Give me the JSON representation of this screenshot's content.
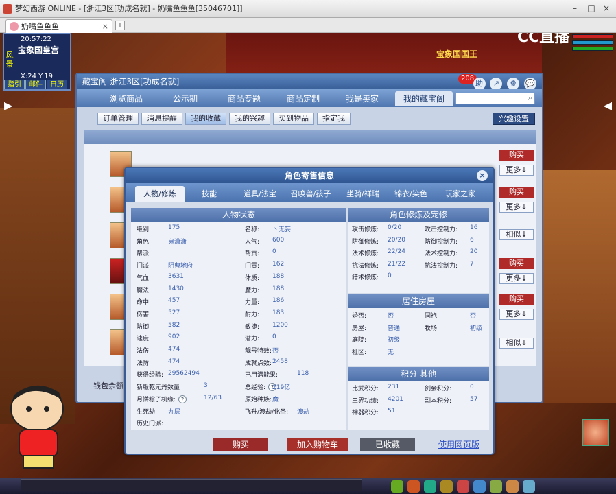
{
  "window": {
    "title": "梦幻西游 ONLINE - [浙江3区[功成名就] - 奶嘴鱼鱼鱼[35046701]]",
    "tab_label": "奶嘴鱼鱼鱼",
    "tab_close": "×",
    "tab_add": "+",
    "minimize": "–",
    "maximize": "□",
    "close": "×"
  },
  "hud": {
    "time": "20:57:22",
    "location": "宝象国皇宫",
    "side": "风景",
    "coords": "X:24  Y:19",
    "buttons": [
      "指引",
      "邮件",
      "日历"
    ],
    "cc_logo": "CC直播",
    "npc": "宝象国国王"
  },
  "panel": {
    "title": "藏宝阁-浙江3区[功成名就]",
    "badge": "208",
    "icons": [
      "助",
      "↗",
      "⚙",
      "💬"
    ],
    "nav": [
      "浏览商品",
      "公示期",
      "商品专题",
      "商品定制",
      "我是卖家",
      "我的藏宝阁"
    ],
    "sub": [
      "订单管理",
      "消息提醒",
      "我的收藏",
      "我的兴趣",
      "买到物品",
      "指定我"
    ],
    "interest": "兴趣设置",
    "buy": "购买",
    "more": "更多↓",
    "similar": "相似↓",
    "wallet": "钱包余额"
  },
  "modal": {
    "title": "角色寄售信息",
    "close": "×",
    "tabs": [
      "人物/修炼",
      "技能",
      "道具/法宝",
      "召唤兽/孩子",
      "坐骑/祥瑞",
      "锦衣/染色",
      "玩家之家"
    ],
    "left_title": "人物状态",
    "left_a": [
      {
        "k": "级别:",
        "v": "175"
      },
      {
        "k": "角色:",
        "v": "鬼潇潇"
      },
      {
        "k": "帮派:",
        "v": ""
      },
      {
        "k": "门派:",
        "v": "阴曹地府"
      },
      {
        "k": "气血:",
        "v": "3631"
      },
      {
        "k": "魔法:",
        "v": "1430"
      },
      {
        "k": "命中:",
        "v": "457"
      },
      {
        "k": "伤害:",
        "v": "527"
      },
      {
        "k": "防御:",
        "v": "582"
      },
      {
        "k": "速度:",
        "v": "902"
      },
      {
        "k": "法伤:",
        "v": "474"
      },
      {
        "k": "法防:",
        "v": "474"
      },
      {
        "k": "获得经验:",
        "v": "29562494"
      },
      {
        "k": "新版乾元丹数量",
        "v": "3"
      },
      {
        "k": "月饼粽子机缘:",
        "v": "12/63"
      },
      {
        "k": "生死劫:",
        "v": "九层"
      },
      {
        "k": "历史门派:",
        "v": ""
      }
    ],
    "left_b": [
      {
        "k": "名称:",
        "v": "丶无妄"
      },
      {
        "k": "人气:",
        "v": "600"
      },
      {
        "k": "帮贡:",
        "v": "0"
      },
      {
        "k": "门贡:",
        "v": "162"
      },
      {
        "k": "体质:",
        "v": "188"
      },
      {
        "k": "魔力:",
        "v": "188"
      },
      {
        "k": "力量:",
        "v": "186"
      },
      {
        "k": "耐力:",
        "v": "183"
      },
      {
        "k": "敏捷:",
        "v": "1200"
      },
      {
        "k": "潜力:",
        "v": "0"
      },
      {
        "k": "靓号特效:",
        "v": "否"
      },
      {
        "k": "成就点数:",
        "v": "2458"
      },
      {
        "k": "已用潜能果:",
        "v": "118"
      },
      {
        "k": "总经验:",
        "v": "219亿"
      },
      {
        "k": "原始种族:",
        "v": "魔"
      },
      {
        "k": "飞升/渡劫/化圣:",
        "v": "渡劫"
      }
    ],
    "cultivation_title": "角色修炼及宠修",
    "cultivation": [
      {
        "k": "攻击修炼:",
        "v": "0/20",
        "k2": "攻击控制力:",
        "v2": "16"
      },
      {
        "k": "防御修炼:",
        "v": "20/20",
        "k2": "防御控制力:",
        "v2": "6"
      },
      {
        "k": "法术修炼:",
        "v": "22/24",
        "k2": "法术控制力:",
        "v2": "20"
      },
      {
        "k": "抗法修炼:",
        "v": "21/22",
        "k2": "抗法控制力:",
        "v2": "7"
      },
      {
        "k": "猎术修炼:",
        "v": "0",
        "k2": "",
        "v2": ""
      }
    ],
    "house_title": "居住房屋",
    "house": [
      {
        "k": "婚否:",
        "v": "否",
        "k2": "同袍:",
        "v2": "否"
      },
      {
        "k": "房屋:",
        "v": "普通",
        "k2": "牧场:",
        "v2": "初级"
      },
      {
        "k": "庭院:",
        "v": "初级",
        "k2": "",
        "v2": ""
      },
      {
        "k": "社区:",
        "v": "无",
        "k2": "",
        "v2": ""
      }
    ],
    "points_title": "积分 其他",
    "points": [
      {
        "k": "比武积分:",
        "v": "231",
        "k2": "剑会积分:",
        "v2": "0"
      },
      {
        "k": "三界功绩:",
        "v": "4201",
        "k2": "副本积分:",
        "v2": "57"
      },
      {
        "k": "神器积分:",
        "v": "51",
        "k2": "",
        "v2": ""
      }
    ],
    "qmark": "?",
    "buy": "购买",
    "cart": "加入购物车",
    "collected": "已收藏",
    "web": "使用网页版"
  },
  "colors": {
    "accent": "#3a5f98",
    "buy": "#b02a2a",
    "value": "#3a5fae"
  }
}
